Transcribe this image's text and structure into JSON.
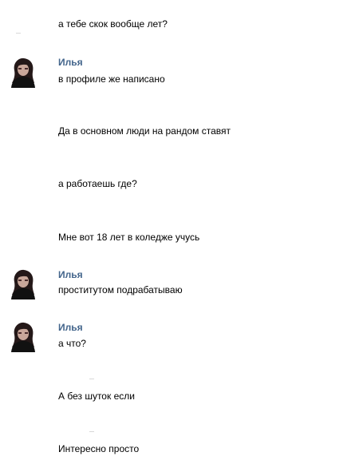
{
  "messages": [
    {
      "text": "а тебе скок вообще лет?"
    },
    {
      "author": "Илья",
      "text": "в профиле же написано",
      "avatar_icon": "user-avatar-icon"
    },
    {
      "text": "Да в основном люди на рандом ставят"
    },
    {
      "text": "а работаешь где?"
    },
    {
      "text": "Мне вот 18 лет в коледже учусь"
    },
    {
      "author": "Илья",
      "text": "проститутом подрабатываю",
      "avatar_icon": "user-avatar-icon"
    },
    {
      "author": "Илья",
      "text": "а что?",
      "avatar_icon": "user-avatar-icon"
    },
    {
      "text": "А без шуток если"
    },
    {
      "text": "Интересно просто"
    }
  ],
  "colors": {
    "author_name": "#42648b",
    "message_text": "#000000",
    "background": "#ffffff"
  }
}
